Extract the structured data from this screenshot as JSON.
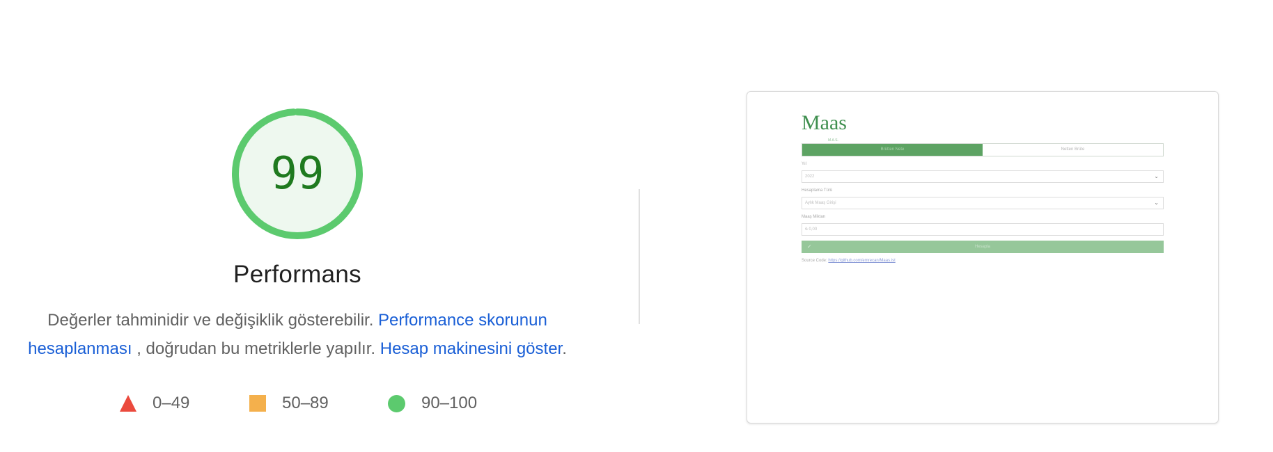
{
  "gauge": {
    "score": "99",
    "score_fraction": 0.99,
    "color": "#5cca6e",
    "fill": "#eef8ef",
    "text_color": "#1f7a1f"
  },
  "category": {
    "title": "Performans"
  },
  "description": {
    "text_1": "Değerler tahminidir ve değişiklik gösterebilir.",
    "link_1": "Performance skorunun hesaplanması",
    "text_2": ", doğrudan bu metriklerle yapılır.",
    "link_2": "Hesap makinesini göster",
    "period": "."
  },
  "legend": {
    "fail": {
      "label": "0–49",
      "icon": "red-triangle-icon",
      "color": "#eb4a3d"
    },
    "average": {
      "label": "50–89",
      "icon": "orange-square-icon",
      "color": "#f4b04c"
    },
    "pass": {
      "label": "90–100",
      "icon": "green-circle-icon",
      "color": "#5cca6e"
    }
  },
  "screenshot": {
    "logo": "Maas",
    "logo_sub": "M.A.S.",
    "tabs": [
      "Brütten Nete",
      "Netten Brüte"
    ],
    "year_label": "Yıl",
    "year_value": "2022",
    "calc_type_label": "Hesaplama Türü",
    "calc_type_value": "Aylık Maaş Girişi",
    "amount_label": "Maaş Miktarı",
    "amount_value": "₺ 0,00",
    "submit_label": "Hesapla",
    "source_prefix": "Source Code:",
    "source_link": "https://github.com/emrecan/Maas.ist"
  }
}
